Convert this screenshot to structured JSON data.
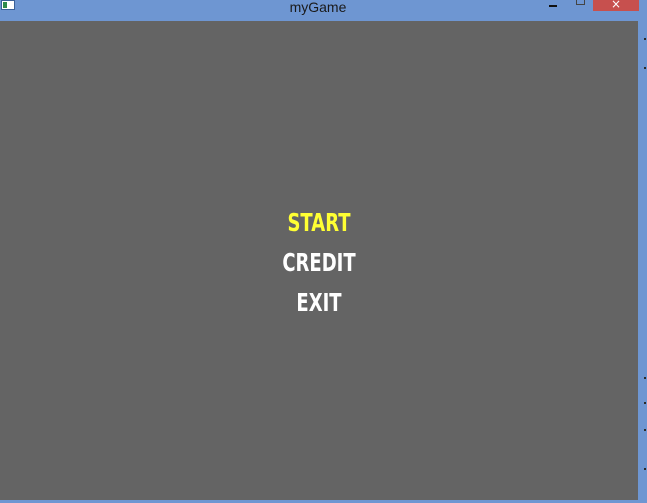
{
  "window": {
    "title": "myGame",
    "close_glyph": "×",
    "icons": {
      "app": "app-icon",
      "minimize": "minimize-icon",
      "maximize": "maximize-icon",
      "close": "close-icon"
    },
    "colors": {
      "titlebar": "#6e96d2",
      "close_button": "#c7504e"
    }
  },
  "game": {
    "background_color": "#646464",
    "menu": {
      "items": [
        {
          "label": "START",
          "selected": true,
          "color": "#ffff33"
        },
        {
          "label": "CREDIT",
          "selected": false,
          "color": "#ffffff"
        },
        {
          "label": "EXIT",
          "selected": false,
          "color": "#ffffff"
        }
      ]
    }
  }
}
